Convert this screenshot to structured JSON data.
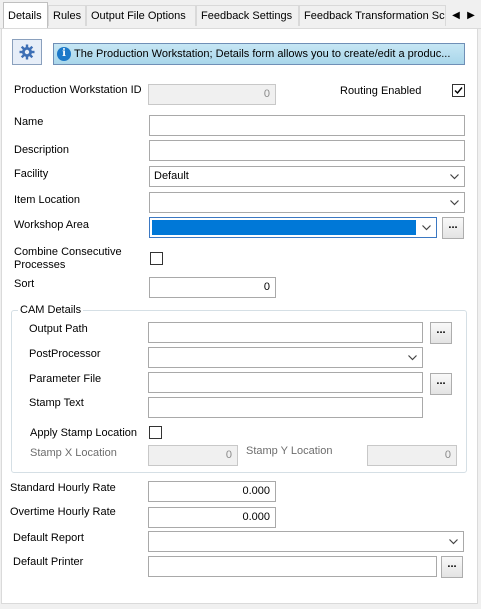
{
  "tabs": [
    {
      "label": "Details",
      "active": true
    },
    {
      "label": "Rules"
    },
    {
      "label": "Output File Options"
    },
    {
      "label": "Feedback Settings"
    },
    {
      "label": "Feedback Transformation Sc"
    }
  ],
  "info": {
    "icon": "gear-icon",
    "text": "The Production Workstation; Details form allows you to create/edit a produc..."
  },
  "form": {
    "workstation_id_label": "Production Workstation ID",
    "workstation_id_value": "0",
    "routing_enabled_label": "Routing Enabled",
    "routing_enabled_checked": true,
    "name_label": "Name",
    "name_value": "",
    "description_label": "Description",
    "description_value": "",
    "facility_label": "Facility",
    "facility_value": "Default",
    "item_location_label": "Item Location",
    "item_location_value": "",
    "workshop_area_label": "Workshop Area",
    "workshop_area_value": "",
    "combine_label_line1": "Combine Consecutive",
    "combine_label_line2": "Processes",
    "combine_checked": false,
    "sort_label": "Sort",
    "sort_value": "0"
  },
  "cam": {
    "group_title": "CAM Details",
    "output_path_label": "Output Path",
    "output_path_value": "",
    "postprocessor_label": "PostProcessor",
    "postprocessor_value": "",
    "parameter_file_label": "Parameter File",
    "parameter_file_value": "",
    "stamp_text_label": "Stamp Text",
    "stamp_text_value": "",
    "apply_stamp_label": "Apply Stamp Location",
    "apply_stamp_checked": false,
    "stamp_x_label": "Stamp X Location",
    "stamp_x_value": "0",
    "stamp_y_label": "Stamp Y Location",
    "stamp_y_value": "0"
  },
  "rates": {
    "standard_label": "Standard Hourly Rate",
    "standard_value": "0.000",
    "overtime_label": "Overtime Hourly Rate",
    "overtime_value": "0.000",
    "default_report_label": "Default Report",
    "default_report_value": "",
    "default_printer_label": "Default Printer",
    "default_printer_value": ""
  },
  "browse_label": "...",
  "colors": {
    "accent": "#0078d7",
    "info_bar": "#b9def0"
  }
}
